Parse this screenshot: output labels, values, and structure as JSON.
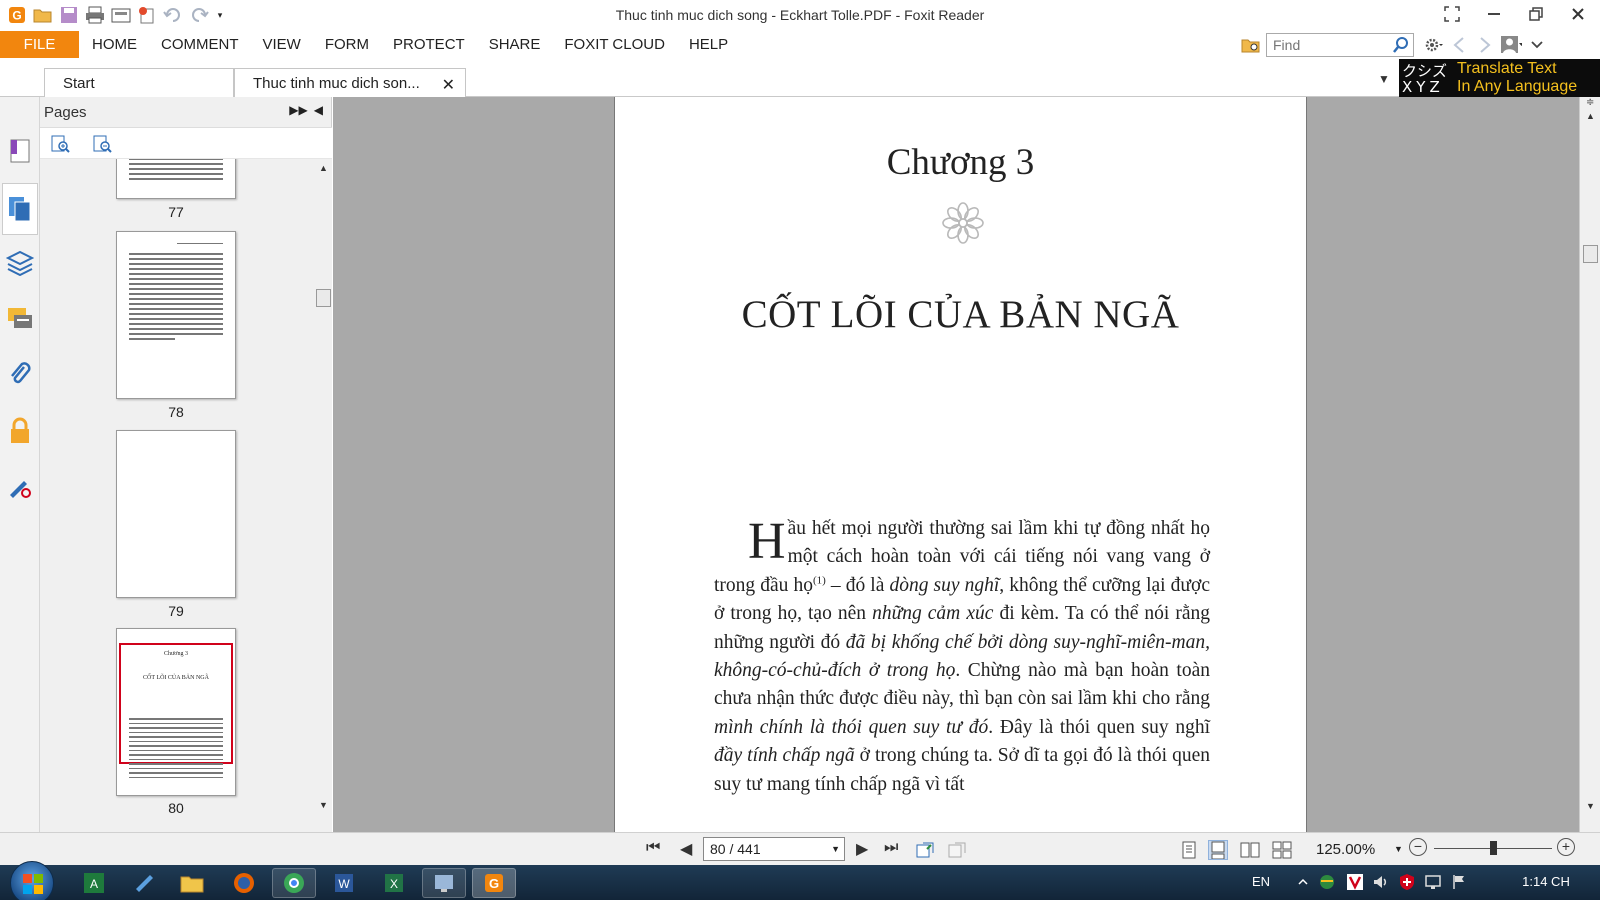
{
  "app": {
    "title": "Thuc tinh muc dich song - Eckhart Tolle.PDF - Foxit Reader"
  },
  "ribbon": {
    "file_label": "FILE",
    "tabs": [
      "HOME",
      "COMMENT",
      "VIEW",
      "FORM",
      "PROTECT",
      "SHARE",
      "FOXIT CLOUD",
      "HELP"
    ],
    "find_placeholder": "Find"
  },
  "doc_tabs": {
    "start_label": "Start",
    "doc_label": "Thuc tinh muc dich son...",
    "close_glyph": "✕"
  },
  "translate_banner": {
    "kana": "クシズ",
    "xyz": "XYZ",
    "line1": "Translate Text",
    "line2": "In Any Language"
  },
  "pages_panel": {
    "title": "Pages",
    "thumbnails": [
      {
        "number": "77"
      },
      {
        "number": "78"
      },
      {
        "number": "79"
      },
      {
        "number": "80",
        "selected": true,
        "mini_chapter": "Chương 3",
        "mini_heading": "CỐT LÕI CỦA BẢN NGÃ"
      }
    ]
  },
  "document": {
    "chapter": "Chương 3",
    "heading": "CỐT LÕI CỦA BẢN NGÃ",
    "dropcap": "H",
    "p1": "ầu hết mọi người thường sai lầm khi tự đồng nhất họ một cách hoàn toàn với cái tiếng nói vang vang ở trong đầu họ",
    "footref": "(1)",
    "p2": " – đó là ",
    "i1": "dòng suy nghĩ",
    "p3": ", không thể cưỡng lại được ở trong họ, tạo nên ",
    "i2": "những cảm xúc",
    "p4": " đi kèm. Ta có thể nói rằng những người đó ",
    "i3": "đã bị khống chế bởi dòng suy-nghĩ-miên-man, không-có-chủ-đích ở trong họ",
    "p5": ". Chừng nào mà bạn hoàn toàn chưa nhận thức được điều này, thì bạn còn sai lầm khi cho rằng ",
    "i4": "mình chính là thói quen suy tư đó",
    "p6": ". Đây là thói quen suy nghĩ ",
    "i5": "đầy tính chấp ngã",
    "p7": " ở trong chúng ta. Sở dĩ ta gọi đó là thói quen suy tư mang tính chấp ngã vì tất"
  },
  "statusbar": {
    "page_indicator": "80 / 441",
    "zoom": "125.00%",
    "zoom_level_fraction": 0.5
  },
  "taskbar": {
    "language": "EN",
    "time": "1:14 CH"
  },
  "colors": {
    "accent_orange": "#f2860e",
    "selected_thumb_border": "#d0021b",
    "translate_text": "#f4c01e"
  }
}
